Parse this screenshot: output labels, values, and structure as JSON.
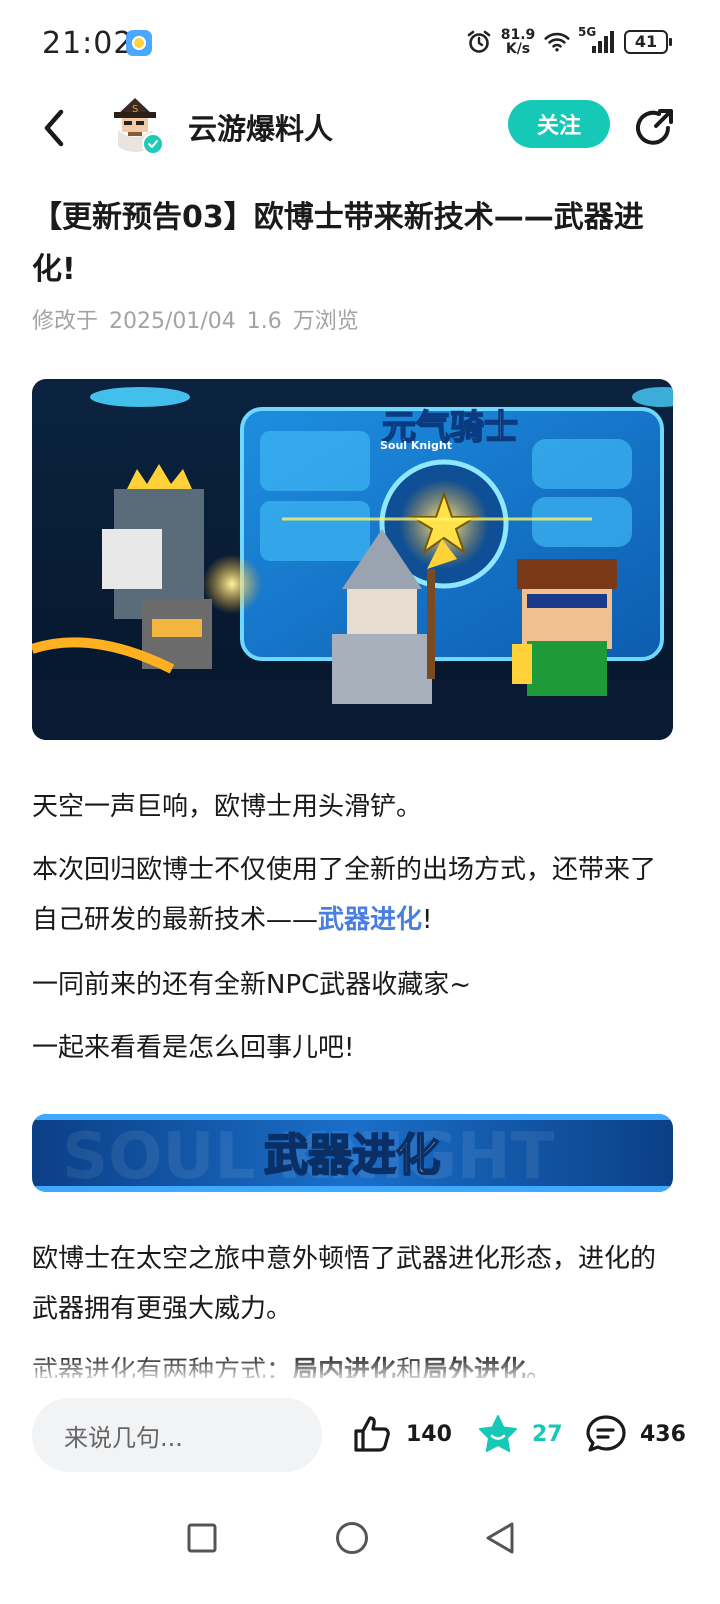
{
  "status_bar": {
    "time": "21:02",
    "net_speed_value": "81.9",
    "net_speed_unit": "K/s",
    "network": "5G",
    "battery": "41"
  },
  "header": {
    "author_name": "云游爆料人",
    "follow_label": "关注",
    "icons": [
      "back-arrow-icon",
      "avatar",
      "verified-icon",
      "share-icon"
    ]
  },
  "article": {
    "title": "【更新预告03】欧博士带来新技术——武器进化!",
    "meta": "修改于 2025/01/04  1.6 万浏览",
    "hero_logo": "元气骑士",
    "hero_logo_en": "Soul Knight",
    "p1": "天空一声巨响，欧博士用头滑铲。",
    "p2_prefix": "本次回归欧博士不仅使用了全新的出场方式，还带来了自己研发的最新技术——",
    "p2_link": "武器进化",
    "p2_suffix": "!",
    "p3": "一同前来的还有全新NPC武器收藏家~",
    "p4": "一起来看看是怎么回事儿吧!",
    "section_title": "武器进化",
    "section_watermark": "SOUL KNIGHT",
    "p5": "欧博士在太空之旅中意外顿悟了武器进化形态，进化的武器拥有更强大威力。",
    "p6_prefix": "武器进化有两种方式：",
    "p6_bold1": "局内进化",
    "p6_mid": "和",
    "p6_bold2": "局外进化",
    "p6_suffix": "。"
  },
  "actions": {
    "comment_placeholder": "来说几句...",
    "likes": "140",
    "stars": "27",
    "comments": "436"
  },
  "colors": {
    "accent": "#16c9b6",
    "link": "#4a7fe0",
    "meta_gray": "#a3a3a3"
  }
}
